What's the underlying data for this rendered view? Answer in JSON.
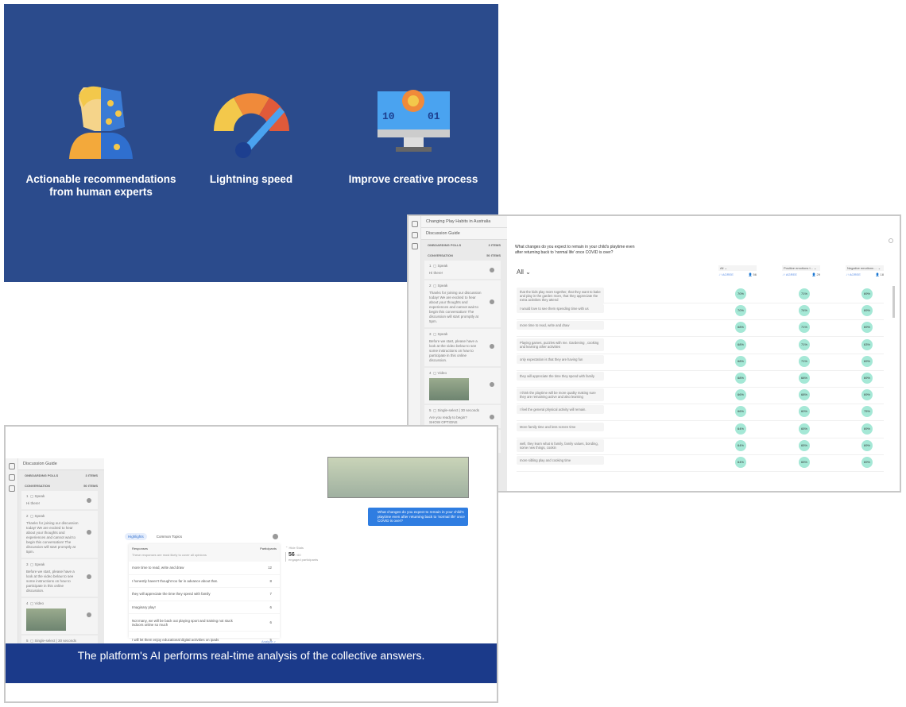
{
  "slide": {
    "features": [
      {
        "icon": "human-robot-icon",
        "label": "Actionable recommendations from human experts"
      },
      {
        "icon": "speedometer-icon",
        "label": "Lightning speed"
      },
      {
        "icon": "computer-gear-icon",
        "label": "Improve creative process"
      }
    ]
  },
  "right": {
    "project_title": "Changing Play Habits in Australia",
    "guide_title": "Discussion Guide",
    "onboarding": "ONBOARDING POLLS",
    "onboarding_count": "3 items",
    "conversation": "CONVERSATION",
    "conversation_count": "50 items",
    "items": [
      {
        "n": "1",
        "type": "Speak",
        "text": "Hi there!"
      },
      {
        "n": "2",
        "type": "Speak",
        "text": "Thanks for joining our discussion today! We are excited to hear about your thoughts and experiences and cannot wait to begin this conversation! The discussion will start promptly at 5pm."
      },
      {
        "n": "3",
        "type": "Speak",
        "text": "Before we start, please have a look at the video below to see some instructions on how to participate in this online discussion."
      },
      {
        "n": "4",
        "type": "Video",
        "text": ""
      },
      {
        "n": "5",
        "type": "Single-select | 30 seconds",
        "text": "Are you ready to begin?",
        "extra": "SHOW OPTIONS"
      },
      {
        "n": "6",
        "type": "Speak",
        "text": "Great, let's start today's discussion!"
      }
    ],
    "question": "What changes do you expect to remain in your child's playtime even after returning back to 'normal life' once COVID is over?",
    "filter": "All",
    "columns": [
      {
        "label": "All",
        "sort": "AGREE",
        "count": "56"
      },
      {
        "label": "Positive emotions t...",
        "sort": "AGREE",
        "count": "29"
      },
      {
        "label": "Negative emotions ...",
        "sort": "AGREE",
        "count": "18"
      }
    ],
    "rows": [
      {
        "text": "that the kids play more together, that they want to bake and play in the garden more, that they appreciate the extra activities they attend",
        "v": [
          "70%",
          "71%",
          "69%"
        ]
      },
      {
        "text": "I would love to see them spending time with us",
        "v": [
          "70%",
          "74%",
          "69%"
        ]
      },
      {
        "text": "more time to read, write and draw",
        "v": [
          "68%",
          "71%",
          "69%"
        ]
      },
      {
        "text": "Playing games, puzzles with me. Gardening , cooking and learning other activities",
        "v": [
          "68%",
          "71%",
          "63%"
        ]
      },
      {
        "text": "only expectation is that they are having fun",
        "v": [
          "68%",
          "71%",
          "69%"
        ]
      },
      {
        "text": "they will appreciate the time they spend with family",
        "v": [
          "68%",
          "68%",
          "69%"
        ]
      },
      {
        "text": "I think the playtime will be more quality making sure they are remaining active and also learning",
        "v": [
          "66%",
          "68%",
          "69%"
        ]
      },
      {
        "text": "I feel the general physical activity will remain.",
        "v": [
          "66%",
          "60%",
          "75%"
        ]
      },
      {
        "text": "More family time and less screen time",
        "v": [
          "64%",
          "65%",
          "69%"
        ]
      },
      {
        "text": "well, they learn what is family, family values, bonding, some new things, cookin",
        "v": [
          "64%",
          "65%",
          "69%"
        ]
      },
      {
        "text": "more sibling play and cooking time",
        "v": [
          "64%",
          "65%",
          "69%"
        ]
      }
    ]
  },
  "bottom": {
    "chat_question": "What changes do you expect to remain in your child's playtime even after returning back to 'normal life' once COVID is over?",
    "tabs": [
      "Highlights",
      "Common Topics"
    ],
    "responses_header": "Responses",
    "responses_sub": "These responses are most likely to cover all opinions",
    "participants_header": "Participants",
    "responses": [
      {
        "text": "more time to read, write and draw",
        "n": "12"
      },
      {
        "text": "I honestly haven't thought too far in advance about that.",
        "n": "8"
      },
      {
        "text": "they will appreciate the time they spend with family",
        "n": "7"
      },
      {
        "text": "Imaginary play!",
        "n": "6"
      },
      {
        "text": "Not many, we will be back out playing sport and training not stuck indoors online so much",
        "n": "6"
      },
      {
        "text": "I will let them enjoy educational digital activities on ipads",
        "n": "5"
      }
    ],
    "analyze": "Analyze >",
    "hide_stats": "Hide Stats",
    "engaged": "56",
    "engaged_total": "/ 60",
    "engaged_label": "engaged participants",
    "caption": "The platform's AI performs real-time analysis of the collective answers."
  },
  "colors": {
    "slide_bg": "#2b4b8c",
    "caption_bg": "#1b3a8a",
    "pill": "#a5e8d6",
    "chat_bubble": "#2f7de1"
  }
}
